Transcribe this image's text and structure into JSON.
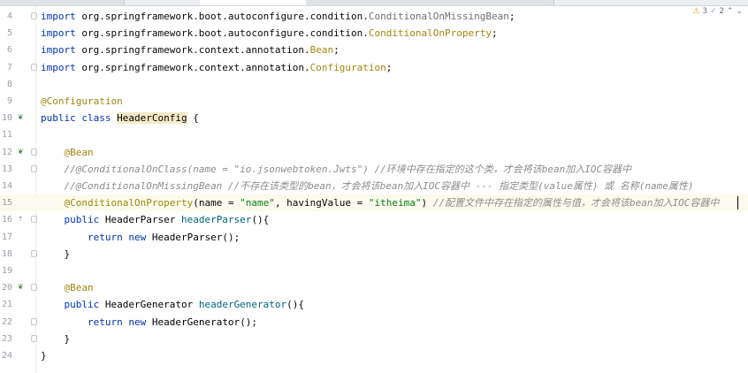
{
  "inspections": {
    "warnings": "3",
    "weak_warnings": "2",
    "up": "⌃",
    "down": "⌄"
  },
  "lines": [
    {
      "no": "4",
      "segments": [
        {
          "c": "kw",
          "t": "import "
        },
        {
          "c": "",
          "t": "org.springframework.boot.autoconfigure.condition."
        },
        {
          "c": "grayed",
          "t": "ConditionalOnMissingBean"
        },
        {
          "c": "",
          "t": ";"
        }
      ]
    },
    {
      "no": "5",
      "segments": [
        {
          "c": "kw",
          "t": "import "
        },
        {
          "c": "",
          "t": "org.springframework.boot.autoconfigure.condition."
        },
        {
          "c": "ann",
          "t": "ConditionalOnProperty"
        },
        {
          "c": "",
          "t": ";"
        }
      ]
    },
    {
      "no": "6",
      "segments": [
        {
          "c": "kw",
          "t": "import "
        },
        {
          "c": "",
          "t": "org.springframework.context.annotation."
        },
        {
          "c": "ann",
          "t": "Bean"
        },
        {
          "c": "",
          "t": ";"
        }
      ]
    },
    {
      "no": "7",
      "segments": [
        {
          "c": "kw",
          "t": "import "
        },
        {
          "c": "",
          "t": "org.springframework.context.annotation."
        },
        {
          "c": "ann",
          "t": "Configuration"
        },
        {
          "c": "",
          "t": ";"
        }
      ]
    },
    {
      "no": "8",
      "segments": []
    },
    {
      "no": "9",
      "segments": [
        {
          "c": "ann",
          "t": "@Configuration"
        }
      ]
    },
    {
      "no": "10",
      "segments": [
        {
          "c": "kw",
          "t": "public class "
        },
        {
          "c": "cls hl",
          "t": "HeaderConfig"
        },
        {
          "c": "",
          "t": " {"
        }
      ]
    },
    {
      "no": "11",
      "segments": []
    },
    {
      "no": "12",
      "segments": [
        {
          "c": "",
          "t": "    "
        },
        {
          "c": "ann",
          "t": "@Bean"
        }
      ]
    },
    {
      "no": "13",
      "segments": [
        {
          "c": "",
          "t": "    "
        },
        {
          "c": "cmt",
          "t": "//@ConditionalOnClass(name = \"io.jsonwebtoken.Jwts\") //环境中存在指定的这个类，才会将该bean加入IOC容器中"
        }
      ]
    },
    {
      "no": "14",
      "segments": [
        {
          "c": "",
          "t": "    "
        },
        {
          "c": "cmt",
          "t": "//@ConditionalOnMissingBean //不存在该类型的bean，才会将该bean加入IOC容器中 --- 指定类型(value属性) 或 名称(name属性)"
        }
      ]
    },
    {
      "no": "15",
      "current": true,
      "segments": [
        {
          "c": "",
          "t": "    "
        },
        {
          "c": "ann",
          "t": "@ConditionalOnProperty"
        },
        {
          "c": "",
          "t": "(name = "
        },
        {
          "c": "str",
          "t": "\"name\""
        },
        {
          "c": "",
          "t": ", havingValue = "
        },
        {
          "c": "str",
          "t": "\"itheima\""
        },
        {
          "c": "",
          "t": ") "
        },
        {
          "c": "cmt",
          "t": "//配置文件中存在指定的属性与值，才会将该bean加入IOC容器中"
        }
      ]
    },
    {
      "no": "16",
      "segments": [
        {
          "c": "",
          "t": "    "
        },
        {
          "c": "kw",
          "t": "public "
        },
        {
          "c": "cls",
          "t": "HeaderParser "
        },
        {
          "c": "fn",
          "t": "headerParser"
        },
        {
          "c": "",
          "t": "(){"
        }
      ]
    },
    {
      "no": "17",
      "segments": [
        {
          "c": "",
          "t": "        "
        },
        {
          "c": "kw",
          "t": "return new "
        },
        {
          "c": "cls",
          "t": "HeaderParser"
        },
        {
          "c": "",
          "t": "();"
        }
      ]
    },
    {
      "no": "18",
      "segments": [
        {
          "c": "",
          "t": "    }"
        }
      ]
    },
    {
      "no": "19",
      "segments": []
    },
    {
      "no": "20",
      "segments": [
        {
          "c": "",
          "t": "    "
        },
        {
          "c": "ann",
          "t": "@Bean"
        }
      ]
    },
    {
      "no": "21",
      "segments": [
        {
          "c": "",
          "t": "    "
        },
        {
          "c": "kw",
          "t": "public "
        },
        {
          "c": "cls",
          "t": "HeaderGenerator "
        },
        {
          "c": "fn",
          "t": "headerGenerator"
        },
        {
          "c": "",
          "t": "(){"
        }
      ]
    },
    {
      "no": "22",
      "segments": [
        {
          "c": "",
          "t": "        "
        },
        {
          "c": "kw",
          "t": "return new "
        },
        {
          "c": "cls",
          "t": "HeaderGenerator"
        },
        {
          "c": "",
          "t": "();"
        }
      ]
    },
    {
      "no": "23",
      "segments": [
        {
          "c": "",
          "t": "    }"
        }
      ]
    },
    {
      "no": "24",
      "segments": [
        {
          "c": "",
          "t": "}"
        }
      ]
    }
  ],
  "gutter_icons": {
    "10": "bean-config-icon",
    "12": "bean-icon",
    "16": "override-icon",
    "20": "bean-icon"
  }
}
